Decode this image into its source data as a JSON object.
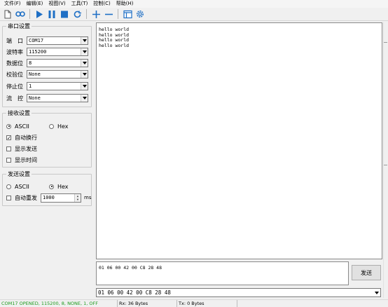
{
  "menu": [
    "文件(F)",
    "编辑(E)",
    "视图(V)",
    "工具(T)",
    "控制(C)",
    "帮助(H)"
  ],
  "toolbar": {
    "icons": [
      "document-icon",
      "loop-icon",
      "play-icon",
      "pause-icon",
      "stop-icon",
      "refresh-icon",
      "plus-icon",
      "minus-icon",
      "window-icon",
      "settings-gear-icon"
    ],
    "colors": {
      "accent": "#1e6fc5"
    }
  },
  "serial": {
    "title": "串口设置",
    "port": {
      "label": "端　口",
      "value": "COM17"
    },
    "baud": {
      "label": "波特率",
      "value": "115200"
    },
    "databits": {
      "label": "数据位",
      "value": "8"
    },
    "parity": {
      "label": "校验位",
      "value": "None"
    },
    "stopbits": {
      "label": "停止位",
      "value": "1"
    },
    "flow": {
      "label": "流　控",
      "value": "None"
    }
  },
  "receive": {
    "title": "接收设置",
    "ascii": "ASCII",
    "hex": "Hex",
    "mode": "ASCII",
    "auto_wrap": {
      "label": "自动换行",
      "checked": true
    },
    "show_send": {
      "label": "显示发送",
      "checked": false
    },
    "show_time": {
      "label": "显示时间",
      "checked": false
    }
  },
  "send_settings": {
    "title": "发送设置",
    "ascii": "ASCII",
    "hex": "Hex",
    "mode": "Hex",
    "auto_resend": {
      "label": "自动重发",
      "checked": false
    },
    "interval": "1000",
    "unit": "ms"
  },
  "receive_text": [
    "hello world",
    "hello world",
    "hello world",
    "hello world"
  ],
  "send_text": "01 06 00 42 00 C8 28 48",
  "send_button": "发送",
  "send_history": "01 06 00 42 00 C8 28 48",
  "status": {
    "connection": "COM17 OPENED, 115200, 8, NONE, 1, OFF",
    "rx": "Rx: 36 Bytes",
    "tx": "Tx: 0 Bytes",
    "connection_color": "#1a9a1a"
  }
}
